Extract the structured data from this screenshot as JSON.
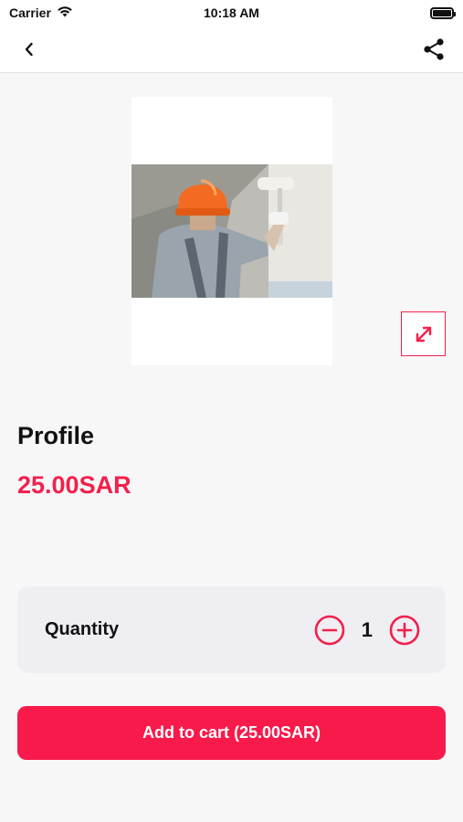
{
  "status_bar": {
    "carrier": "Carrier",
    "time": "10:18 AM"
  },
  "nav": {
    "back_icon": "chevron-left-icon",
    "share_icon": "share-icon"
  },
  "product": {
    "image_alt": "Worker painting wall",
    "name": "Profile",
    "price": "25.00SAR"
  },
  "quantity": {
    "label": "Quantity",
    "value": "1"
  },
  "cart_button": {
    "label": "Add to cart (25.00SAR)"
  },
  "colors": {
    "accent": "#f2204c",
    "button": "#f81a4a",
    "background": "#f7f7f8",
    "card": "#efeef2"
  }
}
